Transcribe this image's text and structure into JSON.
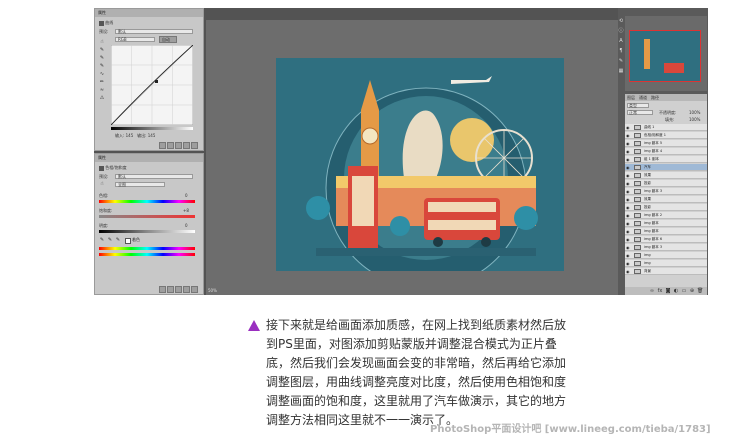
{
  "ps": {
    "curves_panel": {
      "tab": "属性",
      "title": "曲线",
      "preset_label": "预设:",
      "preset_value": "默认",
      "channel_label": "RGB",
      "auto_label": "自动",
      "input_label": "输入:",
      "input_value": "145",
      "output_label": "输出:",
      "output_value": "145"
    },
    "huesat_panel": {
      "tab": "属性",
      "title": "色相/饱和度",
      "preset_label": "预设:",
      "preset_value": "默认",
      "master_label": "全图",
      "hue_label": "色相:",
      "hue_value": "0",
      "sat_label": "饱和度:",
      "sat_value": "+8",
      "light_label": "明度:",
      "light_value": "0",
      "colorize_label": "着色"
    },
    "zoom_left": "50%",
    "zoom_right": "100%",
    "layers": {
      "tabs": [
        "图层",
        "通道",
        "路径"
      ],
      "kind_label": "类型",
      "blend_value": "正常",
      "opacity_label": "不透明度:",
      "opacity_value": "100%",
      "fill_label": "填充:",
      "fill_value": "100%",
      "rows": [
        {
          "name": "曲线 1"
        },
        {
          "name": "色相/饱和度 1"
        },
        {
          "name": "img 副本 5"
        },
        {
          "name": "img 副本 4"
        },
        {
          "name": "组 1 副本"
        },
        {
          "name": "汽车"
        },
        {
          "name": "效果"
        },
        {
          "name": "投影"
        },
        {
          "name": "img 副本 3"
        },
        {
          "name": "效果"
        },
        {
          "name": "投影"
        },
        {
          "name": "img 副本 2"
        },
        {
          "name": "img 副本"
        },
        {
          "name": "img 副本"
        },
        {
          "name": "img 副本 6"
        },
        {
          "name": "img 副本 3"
        },
        {
          "name": "img"
        },
        {
          "name": "img"
        },
        {
          "name": "背景"
        }
      ]
    }
  },
  "caption": "接下来就是给画面添加质感，在网上找到纸质素材然后放到PS里面，对图添加剪贴蒙版并调整混合模式为正片叠底，然后我们会发现画面会变的非常暗，然后再给它添加调整图层，用曲线调整亮度对比度，然后使用色相饱和度调整画面的饱和度，这里就用了汽车做演示，其它的地方调整方法相同这里就不一一演示了。",
  "watermark": "PhotoShop平面设计吧 [www.lineeg.com/tieba/1783]",
  "colors": {
    "accent_triangle": "#9a2fc0",
    "ps_dark": "#535353",
    "canvas_gray": "#6d6d6d",
    "art_teal": "#2f6f80"
  }
}
